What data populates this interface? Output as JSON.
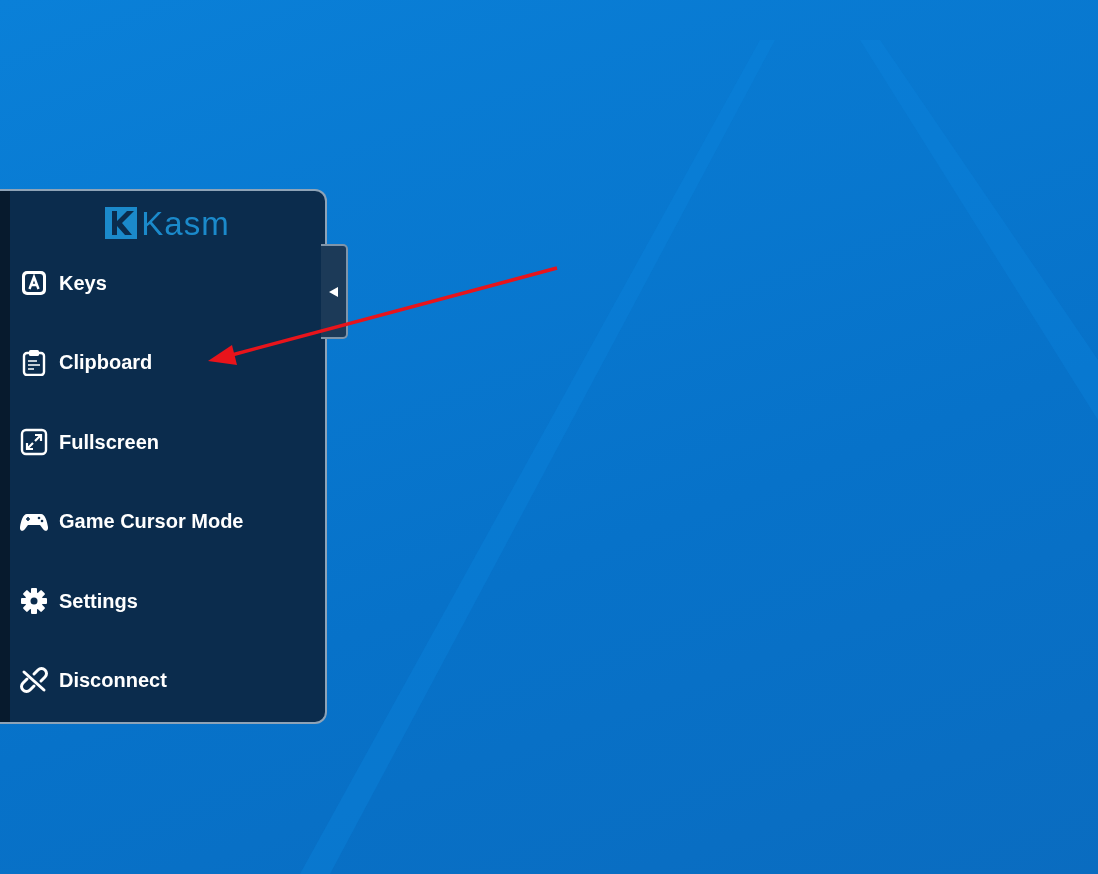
{
  "panel": {
    "logo": "Kasm",
    "items": [
      {
        "label": "Keys"
      },
      {
        "label": "Clipboard"
      },
      {
        "label": "Fullscreen"
      },
      {
        "label": "Game Cursor Mode"
      },
      {
        "label": "Settings"
      },
      {
        "label": "Disconnect"
      }
    ]
  }
}
